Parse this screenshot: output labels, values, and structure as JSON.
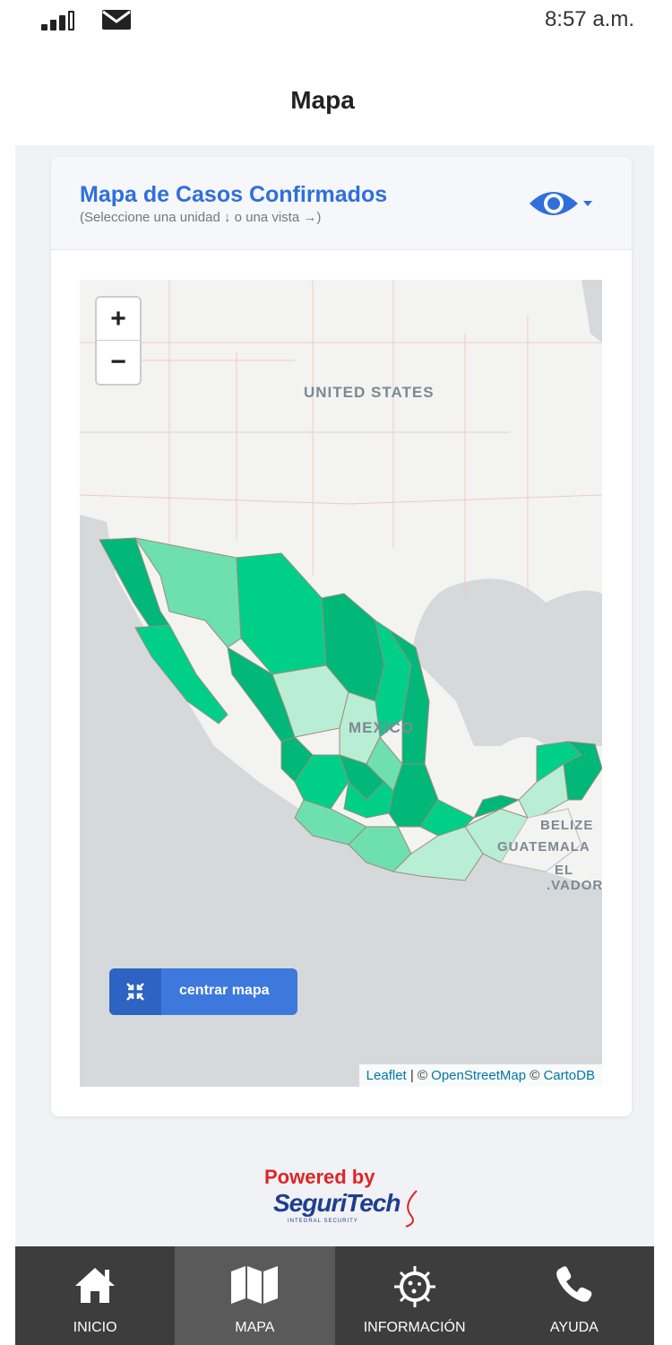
{
  "status_bar": {
    "time": "8:57 a.m."
  },
  "header": {
    "title": "Mapa"
  },
  "card": {
    "title": "Mapa de Casos Confirmados",
    "subtitle": "(Seleccione una unidad ↓ o una vista →)"
  },
  "map": {
    "zoom_in": "+",
    "zoom_out": "−",
    "labels": {
      "united_states": "UNITED STATES",
      "mexico": "MEXICO",
      "belize": "BELIZE",
      "guatemala": "GUATEMALA",
      "el": "EL",
      "salvador": ".VADOR"
    },
    "center_button": "centrar mapa",
    "attribution": {
      "leaflet": "Leaflet",
      "sep": " | © ",
      "osm": "OpenStreetMap",
      "sep2": " © ",
      "carto": "CartoDB"
    },
    "colors": {
      "dark": "#02b77a",
      "mid": "#00cf8a",
      "light": "#6ee0b0",
      "pale": "#b8eed4",
      "water": "#d5d9dc"
    }
  },
  "footer": {
    "powered_by": "Powered by",
    "brand": "SeguriTech",
    "brand_sub": "INTEGRAL SECURITY"
  },
  "nav": [
    {
      "label": "INICIO",
      "icon": "home-icon"
    },
    {
      "label": "MAPA",
      "icon": "map-icon"
    },
    {
      "label": "INFORMACIÓN",
      "icon": "virus-icon"
    },
    {
      "label": "AYUDA",
      "icon": "phone-icon"
    }
  ]
}
